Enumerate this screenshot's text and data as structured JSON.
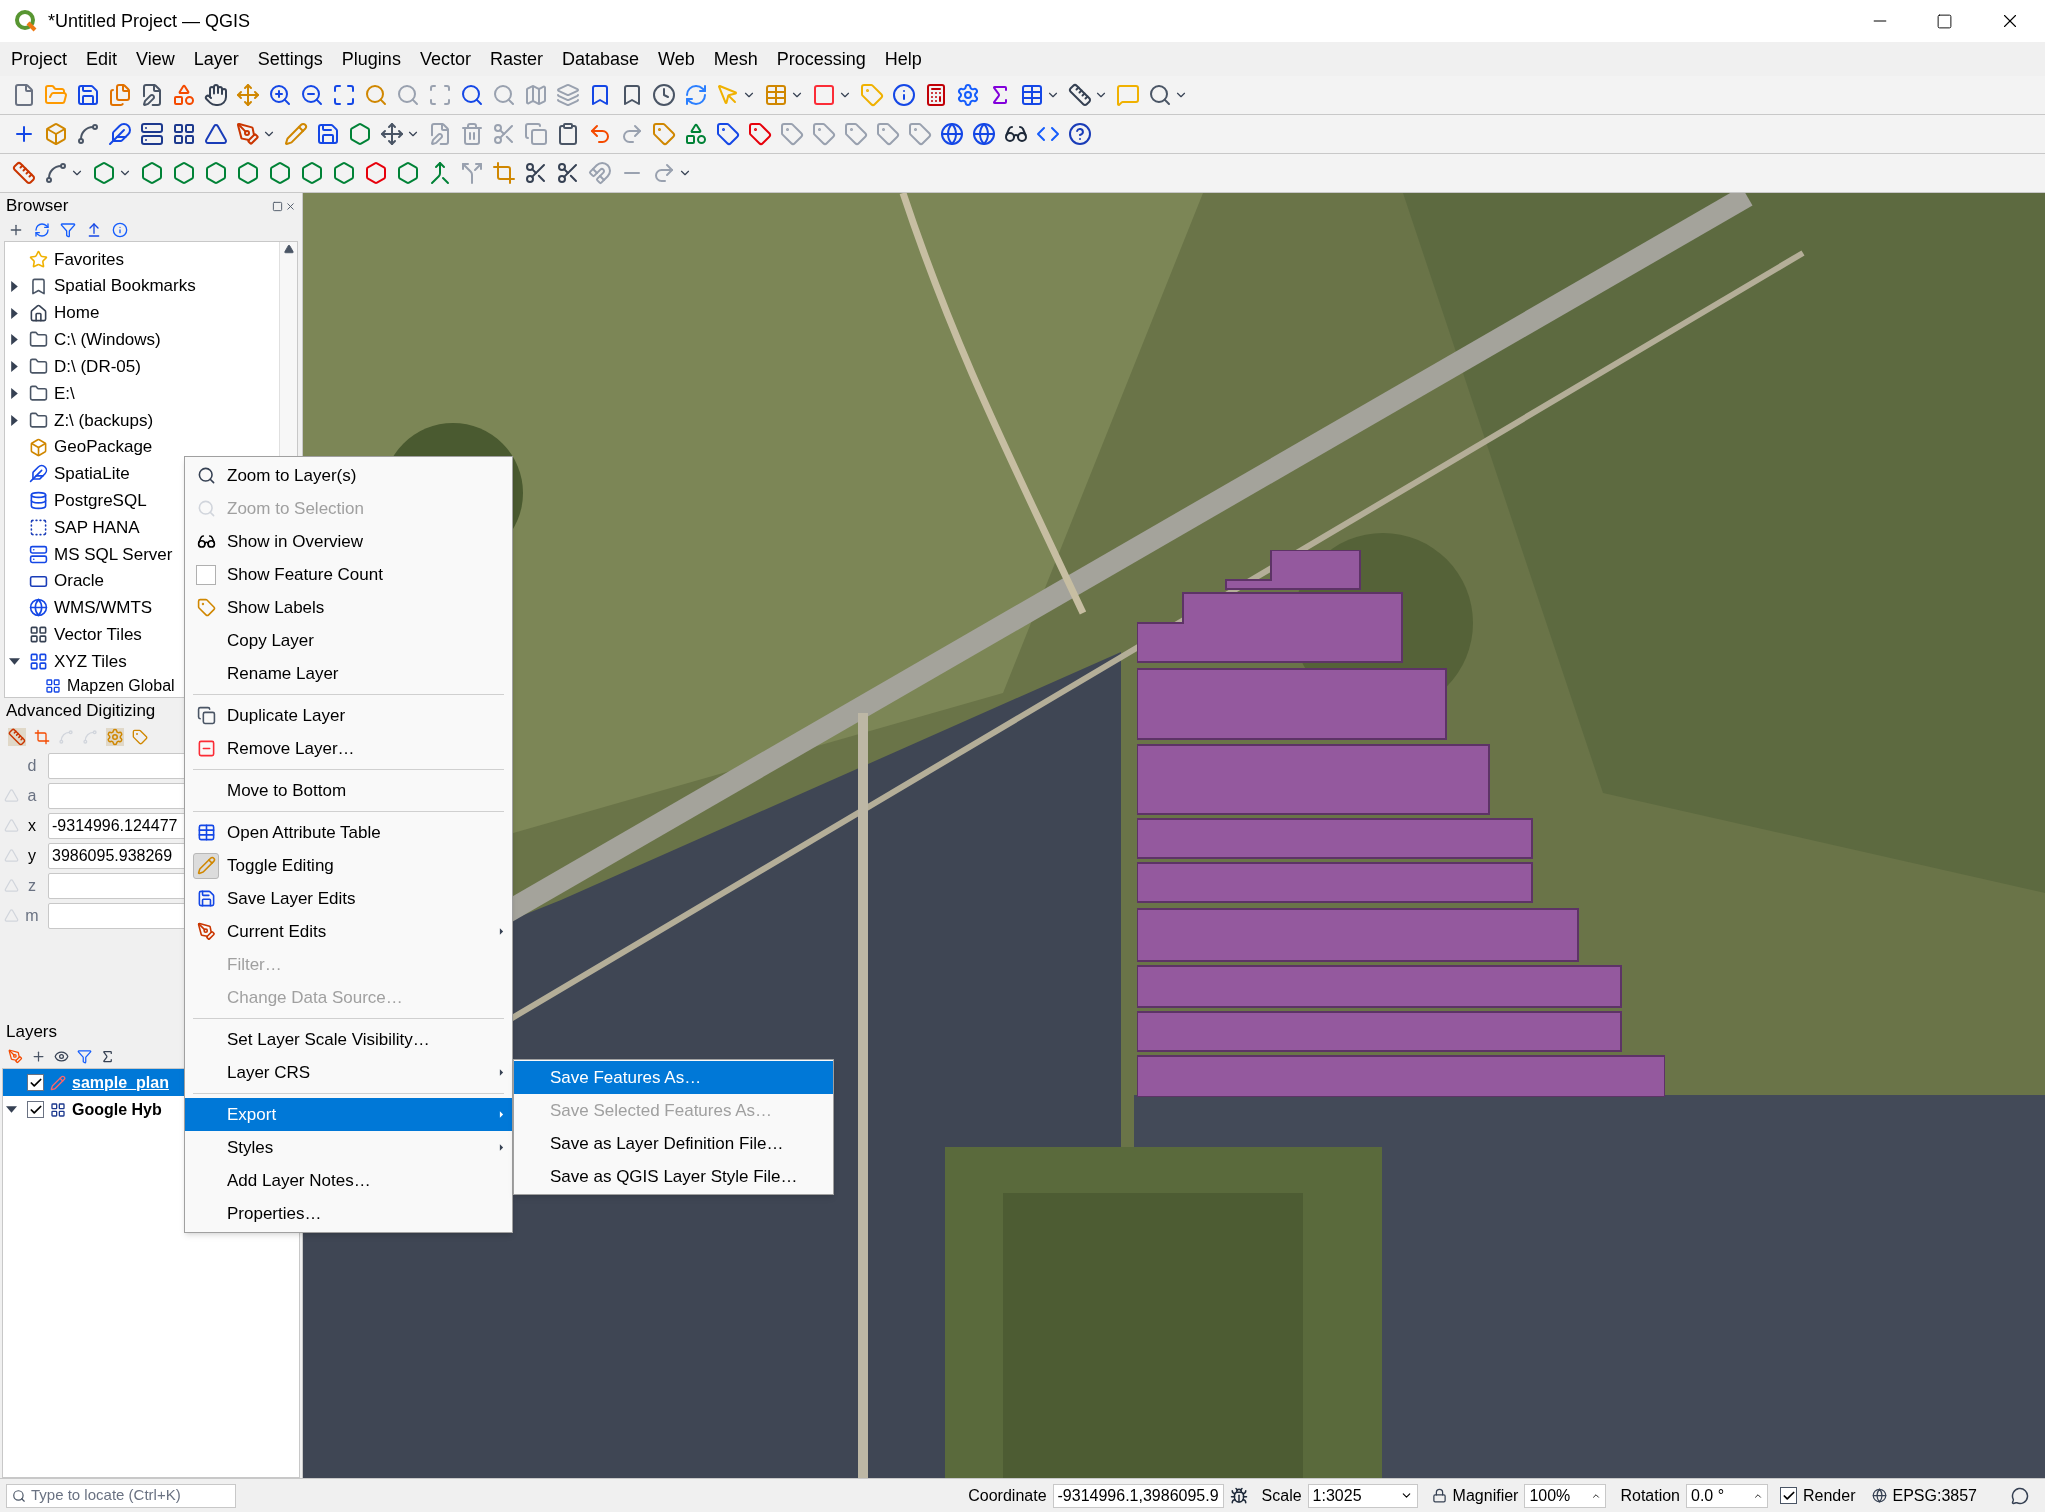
{
  "window": {
    "title": "*Untitled Project — QGIS"
  },
  "menu_bar": [
    "Project",
    "Edit",
    "View",
    "Layer",
    "Settings",
    "Plugins",
    "Vector",
    "Raster",
    "Database",
    "Web",
    "Mesh",
    "Processing",
    "Help"
  ],
  "browser": {
    "title": "Browser",
    "items": [
      {
        "label": "Favorites",
        "expandable": false,
        "expanded": false
      },
      {
        "label": "Spatial Bookmarks",
        "expandable": true,
        "expanded": false
      },
      {
        "label": "Home",
        "expandable": true,
        "expanded": false
      },
      {
        "label": "C:\\ (Windows)",
        "expandable": true,
        "expanded": false
      },
      {
        "label": "D:\\ (DR-05)",
        "expandable": true,
        "expanded": false
      },
      {
        "label": "E:\\",
        "expandable": true,
        "expanded": false
      },
      {
        "label": "Z:\\ (backups)",
        "expandable": true,
        "expanded": false
      },
      {
        "label": "GeoPackage",
        "expandable": false,
        "expanded": false
      },
      {
        "label": "SpatiaLite",
        "expandable": false,
        "expanded": false
      },
      {
        "label": "PostgreSQL",
        "expandable": false,
        "expanded": false
      },
      {
        "label": "SAP HANA",
        "expandable": false,
        "expanded": false
      },
      {
        "label": "MS SQL Server",
        "expandable": false,
        "expanded": false
      },
      {
        "label": "Oracle",
        "expandable": false,
        "expanded": false
      },
      {
        "label": "WMS/WMTS",
        "expandable": false,
        "expanded": false
      },
      {
        "label": "Vector Tiles",
        "expandable": false,
        "expanded": false
      },
      {
        "label": "XYZ Tiles",
        "expandable": true,
        "expanded": true,
        "children": [
          {
            "label": "Mapzen Global"
          }
        ]
      }
    ]
  },
  "advanced_digitizing": {
    "title": "Advanced Digitizing",
    "fields": [
      {
        "label": "d",
        "has_lock": false
      },
      {
        "label": "a",
        "has_lock": true
      },
      {
        "label": "x",
        "has_lock": true,
        "value": "-9314996.124477"
      },
      {
        "label": "y",
        "has_lock": true,
        "value": "3986095.938269"
      },
      {
        "label": "z",
        "has_lock": true
      },
      {
        "label": "m",
        "has_lock": true
      }
    ]
  },
  "layers": {
    "title": "Layers",
    "items": [
      {
        "name": "sample_plan",
        "checked": true,
        "selected": true,
        "expandable": false,
        "expanded": false
      },
      {
        "name": "Google Hyb",
        "checked": true,
        "selected": false,
        "expandable": true,
        "expanded": true
      }
    ]
  },
  "context_menu": {
    "items": [
      {
        "kind": "action",
        "label": "Zoom to Layer(s)",
        "disabled": false,
        "submenu": false,
        "selected": false
      },
      {
        "kind": "action",
        "label": "Zoom to Selection",
        "disabled": true,
        "submenu": false,
        "selected": false
      },
      {
        "kind": "action",
        "label": "Show in Overview",
        "disabled": false,
        "submenu": false,
        "selected": false
      },
      {
        "kind": "check",
        "label": "Show Feature Count",
        "checked": false,
        "disabled": false,
        "submenu": false,
        "selected": false
      },
      {
        "kind": "action",
        "label": "Show Labels",
        "disabled": false,
        "submenu": false,
        "selected": false
      },
      {
        "kind": "action",
        "label": "Copy Layer",
        "disabled": false,
        "submenu": false,
        "selected": false
      },
      {
        "kind": "action",
        "label": "Rename Layer",
        "disabled": false,
        "submenu": false,
        "selected": false
      },
      {
        "kind": "separator"
      },
      {
        "kind": "action",
        "label": "Duplicate Layer",
        "disabled": false,
        "submenu": false,
        "selected": false
      },
      {
        "kind": "action",
        "label": "Remove Layer…",
        "disabled": false,
        "submenu": false,
        "selected": false
      },
      {
        "kind": "separator"
      },
      {
        "kind": "action",
        "label": "Move to Bottom",
        "disabled": false,
        "submenu": false,
        "selected": false
      },
      {
        "kind": "separator"
      },
      {
        "kind": "action",
        "label": "Open Attribute Table",
        "disabled": false,
        "submenu": false,
        "selected": false
      },
      {
        "kind": "check",
        "label": "Toggle Editing",
        "checked": true,
        "disabled": false,
        "submenu": false,
        "selected": false
      },
      {
        "kind": "action",
        "label": "Save Layer Edits",
        "disabled": false,
        "submenu": false,
        "selected": false
      },
      {
        "kind": "action",
        "label": "Current Edits",
        "disabled": false,
        "submenu": true,
        "selected": false
      },
      {
        "kind": "action",
        "label": "Filter…",
        "disabled": true,
        "submenu": false,
        "selected": false
      },
      {
        "kind": "action",
        "label": "Change Data Source…",
        "disabled": true,
        "submenu": false,
        "selected": false
      },
      {
        "kind": "separator"
      },
      {
        "kind": "action",
        "label": "Set Layer Scale Visibility…",
        "disabled": false,
        "submenu": false,
        "selected": false
      },
      {
        "kind": "action",
        "label": "Layer CRS",
        "disabled": false,
        "submenu": true,
        "selected": false
      },
      {
        "kind": "separator"
      },
      {
        "kind": "action",
        "label": "Export",
        "disabled": false,
        "submenu": true,
        "selected": true
      },
      {
        "kind": "action",
        "label": "Styles",
        "disabled": false,
        "submenu": true,
        "selected": false
      },
      {
        "kind": "action",
        "label": "Add Layer Notes…",
        "disabled": false,
        "submenu": false,
        "selected": false
      },
      {
        "kind": "action",
        "label": "Properties…",
        "disabled": false,
        "submenu": false,
        "selected": false
      }
    ]
  },
  "export_submenu": {
    "items": [
      {
        "label": "Save Features As…",
        "disabled": false,
        "selected": true
      },
      {
        "label": "Save Selected Features As…",
        "disabled": true,
        "selected": false
      },
      {
        "label": "Save as Layer Definition File…",
        "disabled": false,
        "selected": false
      },
      {
        "label": "Save as QGIS Layer Style File…",
        "disabled": false,
        "selected": false
      }
    ]
  },
  "status_bar": {
    "locate_placeholder": "Type to locate (Ctrl+K)",
    "coordinate_label": "Coordinate",
    "coordinate": "-9314996.1,3986095.9",
    "scale_label": "Scale",
    "scale": "1:3025",
    "magnifier_label": "Magnifier",
    "magnifier": "100%",
    "rotation_label": "Rotation",
    "rotation": "0.0 °",
    "render_label": "Render",
    "render_checked": true,
    "crs": "EPSG:3857"
  }
}
